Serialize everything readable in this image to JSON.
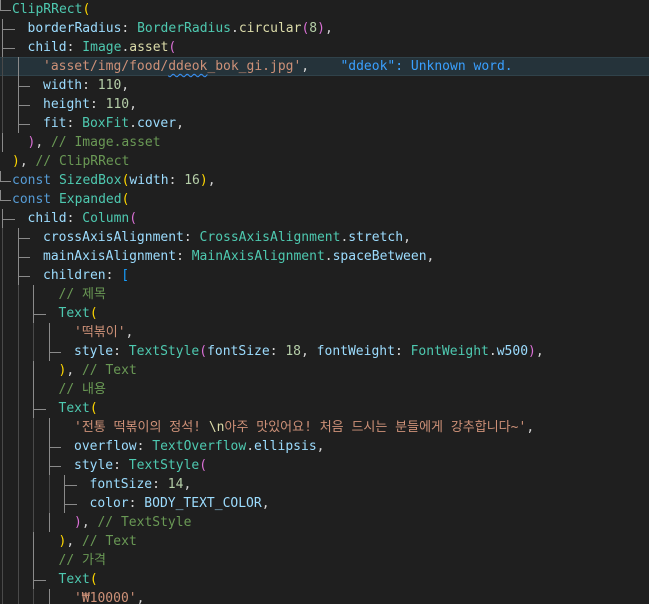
{
  "editor": {
    "language": "dart",
    "diagnostic": {
      "message": "\"ddeok\": Unknown word."
    },
    "lines": [
      {
        "indent": 0,
        "tokens": [
          [
            "cls",
            "ClipRRect"
          ],
          [
            "b1",
            "("
          ]
        ]
      },
      {
        "indent": 1,
        "tokens": [
          [
            "prop",
            "borderRadius"
          ],
          [
            "pun",
            ": "
          ],
          [
            "cls",
            "BorderRadius"
          ],
          [
            "pun",
            "."
          ],
          [
            "fn",
            "circular"
          ],
          [
            "b2",
            "("
          ],
          [
            "num",
            "8"
          ],
          [
            "b2",
            ")"
          ],
          [
            "pun",
            ","
          ]
        ]
      },
      {
        "indent": 1,
        "tokens": [
          [
            "prop",
            "child"
          ],
          [
            "pun",
            ": "
          ],
          [
            "cls",
            "Image"
          ],
          [
            "pun",
            "."
          ],
          [
            "fn",
            "asset"
          ],
          [
            "b2",
            "("
          ]
        ]
      },
      {
        "indent": 2,
        "active": true,
        "tokens": [
          [
            "str",
            "'asset/img/food/"
          ],
          [
            "str squiggle",
            "ddeok"
          ],
          [
            "str",
            "_bok_gi.jpg'"
          ],
          [
            "pun",
            ","
          ],
          [
            "pun",
            "    "
          ],
          [
            "inlay",
            "\"ddeok\": Unknown word."
          ]
        ]
      },
      {
        "indent": 2,
        "tokens": [
          [
            "prop",
            "width"
          ],
          [
            "pun",
            ": "
          ],
          [
            "num",
            "110"
          ],
          [
            "pun",
            ","
          ]
        ]
      },
      {
        "indent": 2,
        "tokens": [
          [
            "prop",
            "height"
          ],
          [
            "pun",
            ": "
          ],
          [
            "num",
            "110"
          ],
          [
            "pun",
            ","
          ]
        ]
      },
      {
        "indent": 2,
        "tokens": [
          [
            "prop",
            "fit"
          ],
          [
            "pun",
            ": "
          ],
          [
            "cls",
            "BoxFit"
          ],
          [
            "pun",
            "."
          ],
          [
            "prop",
            "cover"
          ],
          [
            "pun",
            ","
          ]
        ]
      },
      {
        "indent": 1,
        "tokens": [
          [
            "b2",
            ")"
          ],
          [
            "pun",
            ", "
          ],
          [
            "cmt",
            "// Image.asset"
          ]
        ]
      },
      {
        "indent": 0,
        "tokens": [
          [
            "b1",
            ")"
          ],
          [
            "pun",
            ", "
          ],
          [
            "cmt",
            "// ClipRRect"
          ]
        ]
      },
      {
        "indent": 0,
        "tokens": [
          [
            "kw",
            "const "
          ],
          [
            "cls",
            "SizedBox"
          ],
          [
            "b1",
            "("
          ],
          [
            "prop",
            "width"
          ],
          [
            "pun",
            ": "
          ],
          [
            "num",
            "16"
          ],
          [
            "b1",
            ")"
          ],
          [
            "pun",
            ","
          ]
        ]
      },
      {
        "indent": 0,
        "tokens": [
          [
            "kw",
            "const "
          ],
          [
            "cls",
            "Expanded"
          ],
          [
            "b1",
            "("
          ]
        ]
      },
      {
        "indent": 1,
        "tokens": [
          [
            "prop",
            "child"
          ],
          [
            "pun",
            ": "
          ],
          [
            "cls",
            "Column"
          ],
          [
            "b2",
            "("
          ]
        ]
      },
      {
        "indent": 2,
        "tokens": [
          [
            "prop",
            "crossAxisAlignment"
          ],
          [
            "pun",
            ": "
          ],
          [
            "cls",
            "CrossAxisAlignment"
          ],
          [
            "pun",
            "."
          ],
          [
            "prop",
            "stretch"
          ],
          [
            "pun",
            ","
          ]
        ]
      },
      {
        "indent": 2,
        "tokens": [
          [
            "prop",
            "mainAxisAlignment"
          ],
          [
            "pun",
            ": "
          ],
          [
            "cls",
            "MainAxisAlignment"
          ],
          [
            "pun",
            "."
          ],
          [
            "prop",
            "spaceBetween"
          ],
          [
            "pun",
            ","
          ]
        ]
      },
      {
        "indent": 2,
        "tokens": [
          [
            "prop",
            "children"
          ],
          [
            "pun",
            ": "
          ],
          [
            "b3",
            "["
          ]
        ]
      },
      {
        "indent": 3,
        "tokens": [
          [
            "cmt",
            "// 제목"
          ]
        ]
      },
      {
        "indent": 3,
        "tokens": [
          [
            "cls",
            "Text"
          ],
          [
            "b1",
            "("
          ]
        ]
      },
      {
        "indent": 4,
        "tokens": [
          [
            "str",
            "'떡볶이'"
          ],
          [
            "pun",
            ","
          ]
        ]
      },
      {
        "indent": 4,
        "tokens": [
          [
            "prop",
            "style"
          ],
          [
            "pun",
            ": "
          ],
          [
            "cls",
            "TextStyle"
          ],
          [
            "b2",
            "("
          ],
          [
            "prop",
            "fontSize"
          ],
          [
            "pun",
            ": "
          ],
          [
            "num",
            "18"
          ],
          [
            "pun",
            ", "
          ],
          [
            "prop",
            "fontWeight"
          ],
          [
            "pun",
            ": "
          ],
          [
            "cls",
            "FontWeight"
          ],
          [
            "pun",
            "."
          ],
          [
            "prop",
            "w500"
          ],
          [
            "b2",
            ")"
          ],
          [
            "pun",
            ","
          ]
        ]
      },
      {
        "indent": 3,
        "tokens": [
          [
            "b1",
            ")"
          ],
          [
            "pun",
            ", "
          ],
          [
            "cmt",
            "// Text"
          ]
        ]
      },
      {
        "indent": 3,
        "tokens": [
          [
            "cmt",
            "// 내용"
          ]
        ]
      },
      {
        "indent": 3,
        "tokens": [
          [
            "cls",
            "Text"
          ],
          [
            "b1",
            "("
          ]
        ]
      },
      {
        "indent": 4,
        "tokens": [
          [
            "str",
            "'전통 떡볶이의 정석! "
          ],
          [
            "fn",
            "\\n"
          ],
          [
            "str",
            "아주 맛있어요! 처음 드시는 분들에게 강추합니다~'"
          ],
          [
            "pun",
            ","
          ]
        ]
      },
      {
        "indent": 4,
        "tokens": [
          [
            "prop",
            "overflow"
          ],
          [
            "pun",
            ": "
          ],
          [
            "cls",
            "TextOverflow"
          ],
          [
            "pun",
            "."
          ],
          [
            "prop",
            "ellipsis"
          ],
          [
            "pun",
            ","
          ]
        ]
      },
      {
        "indent": 4,
        "tokens": [
          [
            "prop",
            "style"
          ],
          [
            "pun",
            ": "
          ],
          [
            "cls",
            "TextStyle"
          ],
          [
            "b2",
            "("
          ]
        ]
      },
      {
        "indent": 5,
        "tokens": [
          [
            "prop",
            "fontSize"
          ],
          [
            "pun",
            ": "
          ],
          [
            "num",
            "14"
          ],
          [
            "pun",
            ","
          ]
        ]
      },
      {
        "indent": 5,
        "tokens": [
          [
            "prop",
            "color"
          ],
          [
            "pun",
            ": "
          ],
          [
            "prop",
            "BODY_TEXT_COLOR"
          ],
          [
            "pun",
            ","
          ]
        ]
      },
      {
        "indent": 4,
        "tokens": [
          [
            "b2",
            ")"
          ],
          [
            "pun",
            ", "
          ],
          [
            "cmt",
            "// TextStyle"
          ]
        ]
      },
      {
        "indent": 3,
        "tokens": [
          [
            "b1",
            ")"
          ],
          [
            "pun",
            ", "
          ],
          [
            "cmt",
            "// Text"
          ]
        ]
      },
      {
        "indent": 3,
        "tokens": [
          [
            "cmt",
            "// 가격"
          ]
        ]
      },
      {
        "indent": 3,
        "tokens": [
          [
            "cls",
            "Text"
          ],
          [
            "b1",
            "("
          ]
        ]
      },
      {
        "indent": 4,
        "tokens": [
          [
            "str",
            "'₩10000'"
          ],
          [
            "pun",
            ","
          ]
        ]
      }
    ]
  },
  "colors": {
    "background": "#1f1f1f",
    "active_line": "#25333a",
    "class": "#4ec9b0",
    "keyword": "#569cd6",
    "property": "#9cdcfe",
    "number": "#b5cea8",
    "string": "#ce9178",
    "function": "#dcdcaa",
    "comment": "#6a9955",
    "diagnostic": "#3aa0ff"
  }
}
